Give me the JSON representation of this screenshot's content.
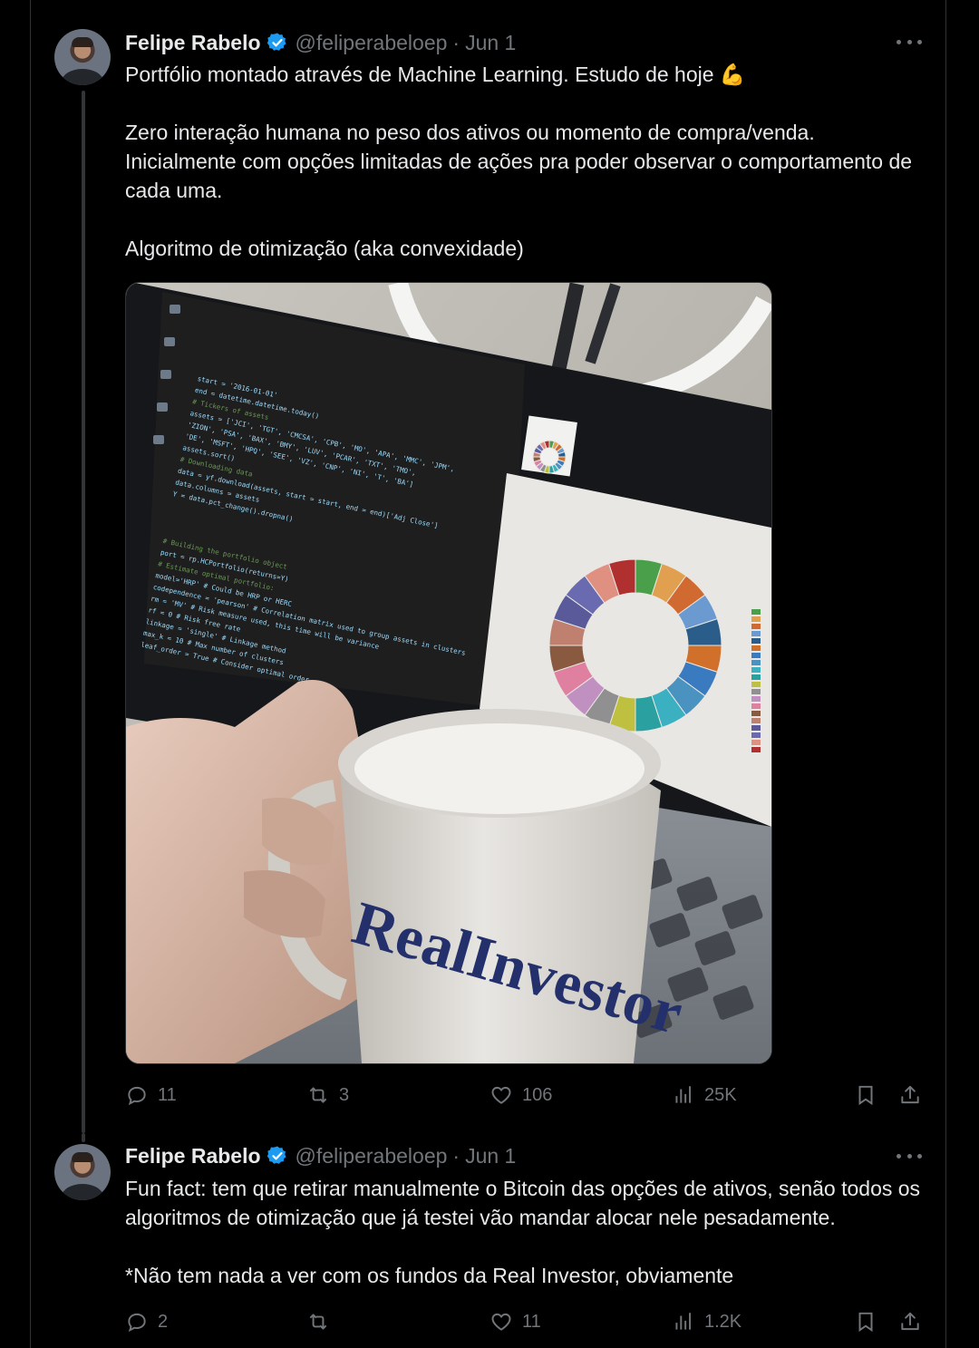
{
  "colors": {
    "background": "#000000",
    "text": "#e7e9ea",
    "muted": "#71767b",
    "verified": "#1d9bf0",
    "divider": "#2f3336"
  },
  "tweets": [
    {
      "author_name": "Felipe Rabelo",
      "handle": "@feliperabeloep",
      "separator": "·",
      "date": "Jun 1",
      "paragraphs": [
        "Portfólio montado através de Machine Learning. Estudo de hoje 💪",
        "Zero interação humana no peso dos ativos ou momento de compra/venda. Inicialmente com opções limitadas de ações pra poder observar o comportamento de cada uma.",
        "Algoritmo de otimização (aka convexidade)"
      ],
      "media": {
        "mug_brand": "RealInvestor",
        "code_lines": [
          "start = '2016-01-01'",
          "end = datetime.datetime.today()",
          "# Tickers of assets",
          "assets = ['JCI', 'TGT', 'CMCSA', 'CPB', 'MO', 'APA', 'MMC', 'JPM',",
          "          'ZION', 'PSA', 'BAX', 'BMY', 'LUV', 'PCAR', 'TXT', 'TMO',",
          "          'DE', 'MSFT', 'HPQ', 'SEE', 'VZ', 'CNP', 'NI', 'T', 'BA']",
          "assets.sort()",
          "# Downloading data",
          "data = yf.download(assets, start = start, end = end)['Adj Close']",
          "data.columns = assets",
          "Y = data.pct_change().dropna()",
          "# Building the portfolio object",
          "port = rp.HCPortfolio(returns=Y)",
          "# Estimate optimal portfolio:",
          "model='HRP' # Could be HRP or HERC",
          "codependence = 'pearson' # Correlation matrix used to group assets in clusters",
          "rm = 'MV' # Risk measure used, this time will be variance",
          "rf = 0 # Risk free rate",
          "linkage = 'single' # Linkage method",
          "max_k = 10 # Max number of clusters",
          "leaf_order = True # Consider optimal order"
        ],
        "donut_colors": [
          "#4aa04a",
          "#e0a050",
          "#d06a30",
          "#6a9ad0",
          "#2b5d8a",
          "#d0702a",
          "#3a7abf",
          "#4a93c0",
          "#3ab0c0",
          "#2aa0a0",
          "#c0c040",
          "#909090",
          "#c090c0",
          "#e080a0",
          "#8a5a40",
          "#c08070",
          "#5a5a9a",
          "#6a6ab0",
          "#e09080",
          "#b03030"
        ]
      },
      "actions": {
        "replies": "11",
        "reposts": "3",
        "likes": "106",
        "views": "25K"
      }
    },
    {
      "author_name": "Felipe Rabelo",
      "handle": "@feliperabeloep",
      "separator": "·",
      "date": "Jun 1",
      "paragraphs": [
        "Fun fact: tem que retirar manualmente o Bitcoin das opções de ativos, senão todos os algoritmos de otimização que já testei vão mandar alocar nele pesadamente.",
        "*Não tem nada a ver com os fundos da Real Investor, obviamente"
      ],
      "actions": {
        "replies": "2",
        "reposts": "",
        "likes": "11",
        "views": "1.2K"
      }
    }
  ]
}
